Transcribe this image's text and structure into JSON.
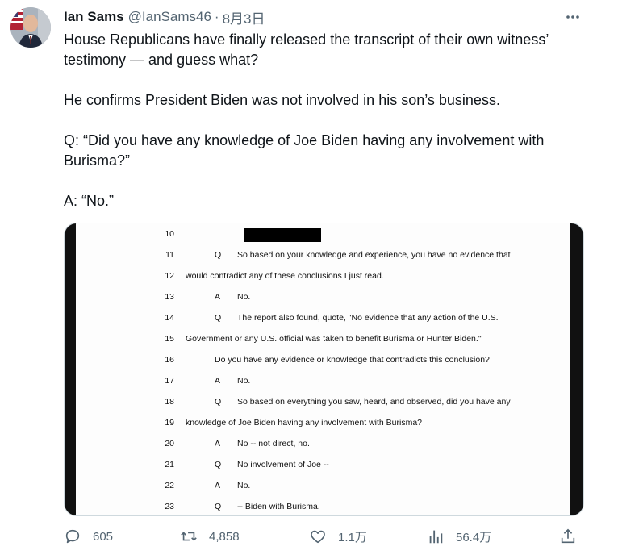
{
  "tweet": {
    "author_name": "Ian Sams",
    "handle": "@IanSams46",
    "separator": "·",
    "date": "8月3日",
    "text_p1": "House Republicans have finally released the transcript of their own witness’ testimony — and guess what?",
    "text_p2": "He confirms President Biden was not involved in his son’s business.",
    "text_p3": "Q: “Did you have any knowledge of Joe Biden having any involvement with Burisma?”",
    "text_p4": "A: “No.”"
  },
  "transcript": {
    "lines": [
      {
        "num": "10",
        "speaker": "",
        "text": ""
      },
      {
        "num": "11",
        "speaker": "Q",
        "text": "So based on your knowledge and experience, you have no evidence that"
      },
      {
        "num": "12",
        "speaker": "",
        "text": "would contradict any of these conclusions I just read."
      },
      {
        "num": "13",
        "speaker": "A",
        "text": "No."
      },
      {
        "num": "14",
        "speaker": "Q",
        "text": "The report also found, quote, \"No evidence that any action of the U.S."
      },
      {
        "num": "15",
        "speaker": "",
        "text": "Government or any U.S. official was taken to benefit Burisma or Hunter Biden.\""
      },
      {
        "num": "16",
        "speaker": "",
        "text": "Do you have any evidence or knowledge that contradicts this conclusion?"
      },
      {
        "num": "17",
        "speaker": "A",
        "text": "No."
      },
      {
        "num": "18",
        "speaker": "Q",
        "text": "So based on everything you saw, heard, and observed, did you have any"
      },
      {
        "num": "19",
        "speaker": "",
        "text": "knowledge of Joe Biden having any involvement with Burisma?"
      },
      {
        "num": "20",
        "speaker": "A",
        "text": "No -- not direct, no."
      },
      {
        "num": "21",
        "speaker": "Q",
        "text": "No involvement of Joe --"
      },
      {
        "num": "22",
        "speaker": "A",
        "text": "No."
      },
      {
        "num": "23",
        "speaker": "Q",
        "text": "-- Biden with Burisma."
      }
    ]
  },
  "actions": {
    "replies": "605",
    "retweets": "4,858",
    "likes": "1.1万",
    "views": "56.4万"
  },
  "icons": {
    "more": "more-horizontal-icon",
    "reply": "reply-icon",
    "retweet": "retweet-icon",
    "like": "heart-icon",
    "views": "views-icon",
    "share": "share-icon"
  }
}
